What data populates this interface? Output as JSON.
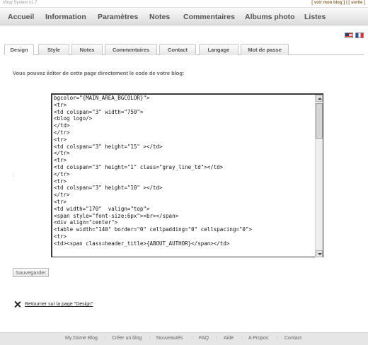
{
  "topbar": {
    "brand": "Vboy System v1.7",
    "links": [
      "[ voir mon blog ]",
      "[ sortie ]"
    ],
    "separator": "|"
  },
  "nav": {
    "items": [
      "Accueil",
      "Information",
      "Paramètres",
      "Notes",
      "Commentaires",
      "Albums photo",
      "Listes"
    ]
  },
  "flags": [
    "us-flag-icon",
    "fr-flag-icon"
  ],
  "tabs": {
    "items": [
      "Design",
      "Style",
      "Notes",
      "Commentaires",
      "Contact",
      "Langage",
      "Mot de passe"
    ],
    "active": "Design"
  },
  "content": {
    "intro": "Vous pouvez éditer de cette page directement le code de votre blog:",
    "colon": ":",
    "code": "bgcolor=\"{MAIN_AREA_BGCOLOR}\">\n<tr>\n<td colspan=\"3\" width=\"750\">\n<blog logo/>\n</td>\n</tr>\n<tr>\n<td colspan=\"3\" height=\"15\" ></td>\n</tr>\n<tr>\n<td colspan=\"3\" height=\"1\" class=\"gray_line_td\"></td>\n</tr>\n<tr>\n<td colspan=\"3\" height=\"10\" ></td>\n</tr>\n<tr>\n<td width=\"170\"  valign=\"top\">\n<span style=\"font-size:6px\"><br></span>\n<div align=\"center\">\n<table width=\"140\" border=\"0\" cellpadding=\"0\" cellspacing=\"0\">\n<tr>\n<td><span class=header_title>{ABOUT_AUTHOR}</span></td>",
    "save_label": "Sauvegarder",
    "back_label": "Retourner sur la page \"Design\""
  },
  "footer": {
    "links": [
      "My Dome Blog",
      "Créer un blog",
      "Nouveautés",
      "FAQ",
      "Aide",
      "A Propos",
      "Contact"
    ],
    "separator": ":"
  }
}
